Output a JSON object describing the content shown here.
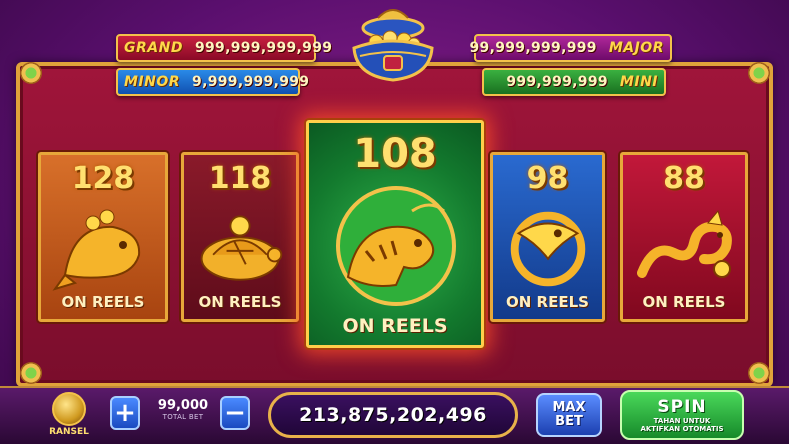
{
  "jackpots": {
    "grand": {
      "label": "GRAND",
      "value": "999,999,999,999"
    },
    "minor": {
      "label": "MINOR",
      "value": "9,999,999,999"
    },
    "major": {
      "label": "MAJOR",
      "value": "99,999,999,999"
    },
    "mini": {
      "label": "MINI",
      "value": "999,999,999"
    }
  },
  "cards": [
    {
      "number": "128",
      "caption": "ON REELS",
      "icon": "golden-koi-fish-icon"
    },
    {
      "number": "118",
      "caption": "ON REELS",
      "icon": "golden-turtle-icon"
    },
    {
      "number": "108",
      "caption": "ON REELS",
      "icon": "golden-tiger-icon",
      "highlighted": true
    },
    {
      "number": "98",
      "caption": "ON REELS",
      "icon": "golden-phoenix-icon"
    },
    {
      "number": "88",
      "caption": "ON REELS",
      "icon": "golden-dragon-icon"
    }
  ],
  "bottom_bar": {
    "bank_label": "RANSEL",
    "plus_label": "+",
    "minus_label": "−",
    "total_bet_value": "99,000",
    "total_bet_label": "TOTAL BET",
    "balance": "213,875,202,496",
    "max_bet_line1": "MAX",
    "max_bet_line2": "BET",
    "spin_label": "SPIN",
    "spin_sub_line1": "TAHAN UNTUK",
    "spin_sub_line2": "AKTIFKAN OTOMATIS"
  },
  "colors": {
    "background": "#5a0f6e",
    "frame_gold": "#e0a33a",
    "highlight_glow": "#ff5028",
    "number_gold": "#ffe070"
  }
}
